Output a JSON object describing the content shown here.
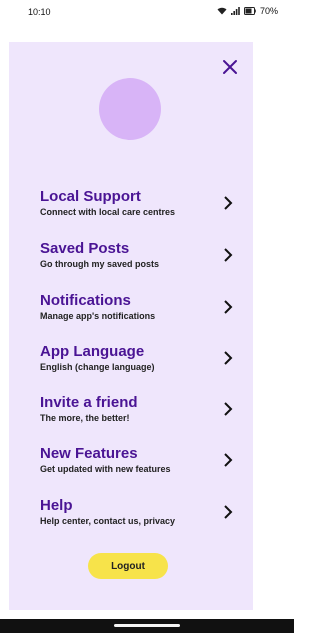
{
  "status": {
    "time": "10:10",
    "battery": "70%",
    "icons": [
      "wifi-icon",
      "signal-icon",
      "battery-icon"
    ]
  },
  "panel": {
    "close_icon": "close-icon",
    "avatar_color": "#d8b4f7",
    "background": "#efe6fc"
  },
  "menu": {
    "items": [
      {
        "title": "Local Support",
        "subtitle": "Connect with local care centres"
      },
      {
        "title": "Saved Posts",
        "subtitle": "Go through my saved posts"
      },
      {
        "title": "Notifications",
        "subtitle": "Manage app's notifications"
      },
      {
        "title": "App Language",
        "subtitle": "English (change language)"
      },
      {
        "title": "Invite a friend",
        "subtitle": "The more, the better!"
      },
      {
        "title": "New Features",
        "subtitle": "Get updated with new features"
      },
      {
        "title": "Help",
        "subtitle": "Help center, contact us, privacy"
      }
    ],
    "chevron_icon": "chevron-right-icon"
  },
  "logout": {
    "label": "Logout"
  },
  "colors": {
    "accent": "#4a1494",
    "logout_button": "#f7e34a"
  }
}
